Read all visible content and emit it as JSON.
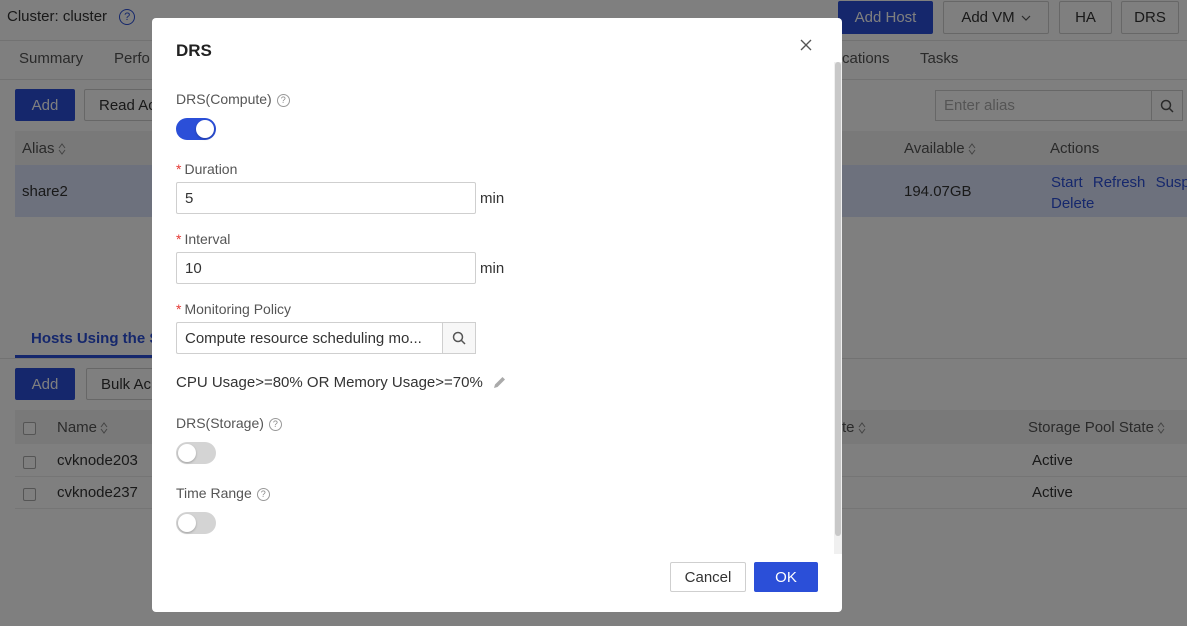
{
  "cluster": {
    "label": "Cluster: cluster",
    "buttons": {
      "add_host": "Add Host",
      "add_vm": "Add VM",
      "ha": "HA",
      "drs": "DRS"
    }
  },
  "tabs": [
    {
      "label": "Summary"
    },
    {
      "label": "Perfo"
    },
    {
      "label": "cations"
    },
    {
      "label": "Tasks"
    }
  ],
  "storage_toolbar": {
    "add": "Add",
    "read_action": "Read Ac",
    "alias_placeholder": "Enter alias"
  },
  "storage_table": {
    "headers": {
      "alias": "Alias",
      "available": "Available",
      "actions": "Actions"
    },
    "rows": [
      {
        "alias": "share2",
        "available": "194.07GB",
        "actions": [
          "Start",
          "Refresh",
          "Susp",
          "Delete"
        ]
      }
    ]
  },
  "hosts_section": {
    "tab": "Hosts Using the S",
    "add": "Add",
    "bulk_action": "Bulk Ac",
    "headers": {
      "name": "Name",
      "state_partial": "te",
      "storage_pool_state": "Storage Pool State"
    },
    "rows": [
      {
        "name": "cvknode203",
        "storage_pool_state": "Active"
      },
      {
        "name": "cvknode237",
        "storage_pool_state": "Active"
      }
    ]
  },
  "dialog": {
    "title": "DRS",
    "drs_compute": {
      "label": "DRS(Compute)",
      "enabled": true
    },
    "duration": {
      "label": "Duration",
      "value": "5",
      "unit": "min"
    },
    "interval": {
      "label": "Interval",
      "value": "10",
      "unit": "min"
    },
    "monitoring_policy": {
      "label": "Monitoring Policy",
      "value": "Compute resource scheduling mo..."
    },
    "policy_condition": "CPU Usage>=80% OR Memory Usage>=70%",
    "drs_storage": {
      "label": "DRS(Storage)",
      "enabled": false
    },
    "time_range": {
      "label": "Time Range",
      "enabled": false
    },
    "cancel": "Cancel",
    "ok": "OK"
  },
  "colors": {
    "primary": "#2b4fd8",
    "overlay": "rgba(0,0,0,0.5)",
    "required": "#e53935",
    "selected_row": "#dbe3fb"
  },
  "icons": [
    "help-icon",
    "search-icon",
    "close-icon",
    "edit-icon",
    "chevron-down-icon",
    "sort-icon"
  ]
}
